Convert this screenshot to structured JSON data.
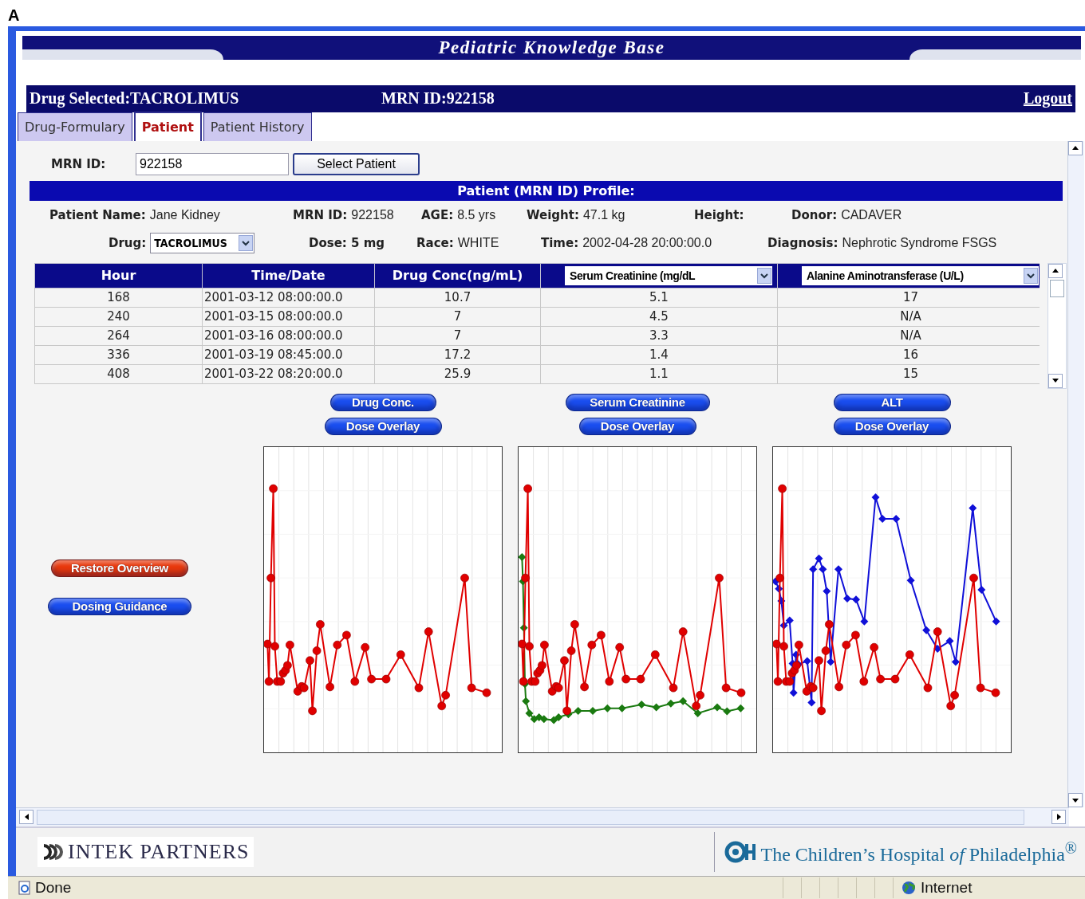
{
  "figure_label": "A",
  "banner": {
    "title": "Pediatric Knowledge Base"
  },
  "info_bar": {
    "drug_label": "Drug Selected:",
    "drug": "TACROLIMUS",
    "mrn_label": "MRN ID:",
    "mrn": "922158",
    "logout": "Logout"
  },
  "tabs": [
    {
      "label": "Drug-Formulary",
      "selected": false
    },
    {
      "label": "Patient",
      "selected": true
    },
    {
      "label": "Patient History",
      "selected": false
    }
  ],
  "mrn_search": {
    "label": "MRN ID:",
    "value": "922158",
    "button": "Select Patient"
  },
  "profile": {
    "title": "Patient (MRN ID) Profile:",
    "rows": [
      [
        {
          "kind": "text",
          "label": "Patient Name:",
          "value": "Jane Kidney"
        },
        {
          "kind": "text",
          "label": "MRN ID:",
          "value": "922158"
        },
        {
          "kind": "text",
          "label": "AGE:",
          "value": "8.5 yrs"
        },
        {
          "kind": "text",
          "label": "Weight:",
          "value": "47.1 kg"
        },
        {
          "kind": "text",
          "label": "Height:"
        },
        {
          "kind": "text",
          "label": "Donor:",
          "value": "CADAVER"
        }
      ],
      [
        {
          "kind": "select",
          "label": "Drug:",
          "value": "TACROLIMUS"
        },
        {
          "kind": "bold",
          "label": "Dose: 5 mg"
        },
        {
          "kind": "text",
          "label": "Race:",
          "value": "WHITE"
        },
        {
          "kind": "text",
          "label": "Time:",
          "value": "2002-04-28 20:00:00.0"
        },
        "",
        {
          "kind": "text",
          "label": "Diagnosis:",
          "value": "Nephrotic Syndrome FSGS"
        }
      ]
    ]
  },
  "table": {
    "columns": [
      {
        "kind": "plain",
        "label": "Hour"
      },
      {
        "kind": "plain",
        "label": "Time/Date"
      },
      {
        "kind": "plain",
        "label": "Drug Conc(ng/mL)"
      },
      {
        "kind": "select",
        "label": "Serum Creatinine (mg/dL"
      },
      {
        "kind": "select",
        "label": "Alanine Aminotransferase (U/L)"
      }
    ],
    "rows": [
      [
        "168",
        "2001-03-12 08:00:00.0",
        "10.7",
        "5.1",
        "17"
      ],
      [
        "240",
        "2001-03-15 08:00:00.0",
        "7",
        "4.5",
        "N/A"
      ],
      [
        "264",
        "2001-03-16 08:00:00.0",
        "7",
        "3.3",
        "N/A"
      ],
      [
        "336",
        "2001-03-19 08:45:00.0",
        "17.2",
        "1.4",
        "16"
      ],
      [
        "408",
        "2001-03-22 08:20:00.0",
        "25.9",
        "1.1",
        "15"
      ]
    ]
  },
  "side_buttons": [
    {
      "label": "Restore Overview",
      "color": "#e8380c"
    },
    {
      "label": "Dosing Guidance",
      "color": "#1a4ef0"
    }
  ],
  "charts": [
    {
      "kind": "conc",
      "buttons": [
        "Drug Conc.",
        "Dose Overlay"
      ]
    },
    {
      "kind": "creatinine",
      "buttons": [
        "Serum Creatinine",
        "Dose Overlay"
      ]
    },
    {
      "kind": "alt",
      "buttons": [
        "ALT",
        "Dose Overlay"
      ]
    }
  ],
  "footer": {
    "left_logo": "INTEK PARTNERS",
    "right_logo": "The Children’s Hospital *of* Philadelphia$^{®}$"
  },
  "status_bar": {
    "status": "Done",
    "zone": "Internet"
  }
}
